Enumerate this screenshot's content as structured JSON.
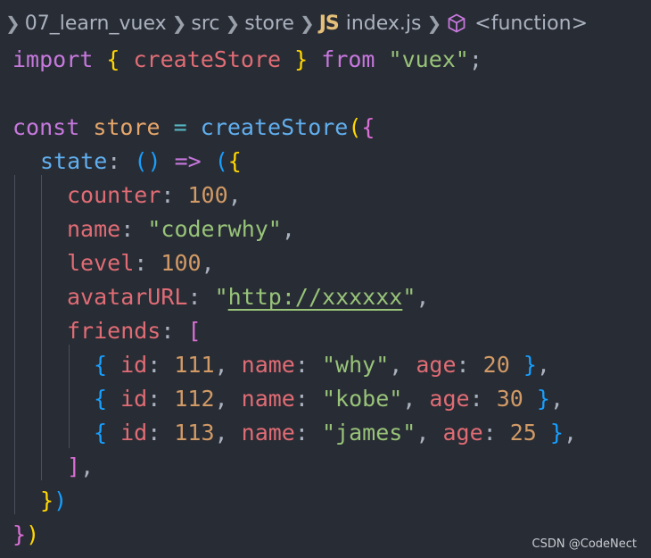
{
  "breadcrumb": {
    "items": [
      "07_learn_vuex",
      "src",
      "store",
      "index.js",
      "<function>"
    ],
    "js_badge": "JS"
  },
  "code": {
    "l1": [
      "import",
      "{",
      "createStore",
      "}",
      "from",
      "\"vuex\"",
      ";"
    ],
    "l3": [
      "const",
      "store",
      "=",
      "createStore",
      "(",
      "{"
    ],
    "l4": [
      "state",
      ":",
      "()",
      "=>",
      "(",
      "{"
    ],
    "l5": [
      "counter",
      ":",
      "100",
      ","
    ],
    "l6": [
      "name",
      ":",
      "\"coderwhy\"",
      ","
    ],
    "l7": [
      "level",
      ":",
      "100",
      ","
    ],
    "l8": [
      "avatarURL",
      ":",
      "\"",
      "http://xxxxxx",
      "\"",
      ","
    ],
    "l9": [
      "friends",
      ":",
      "["
    ],
    "friends": [
      {
        "id": "111",
        "name": "\"why\"",
        "age": "20"
      },
      {
        "id": "112",
        "name": "\"kobe\"",
        "age": "30"
      },
      {
        "id": "113",
        "name": "\"james\"",
        "age": "25"
      }
    ],
    "keys": {
      "id": "id",
      "name": "name",
      "age": "age",
      "colon": ":",
      "comma": ",",
      "lb": "{",
      "rb": "}"
    },
    "l13": [
      "]",
      ","
    ],
    "l14": [
      "}",
      ")"
    ],
    "l15": [
      "}",
      ")"
    ]
  },
  "watermark": "CSDN @CodeNect"
}
